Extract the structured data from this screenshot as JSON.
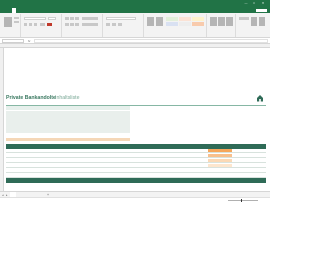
{
  "app": {
    "window_title": "",
    "accent": "#217346"
  },
  "window_controls": [
    {
      "name": "minimize-icon",
      "glyph": "—"
    },
    {
      "name": "maximize-icon",
      "glyph": "□"
    },
    {
      "name": "close-icon",
      "glyph": "✕"
    }
  ],
  "menu": {
    "items": [
      "",
      "",
      "",
      "",
      "",
      "",
      "",
      "",
      "",
      ""
    ],
    "active_index": 1
  },
  "formula_bar": {
    "name_box": "",
    "fx_label": "fx",
    "formula": ""
  },
  "sheet": {
    "title": "Private Bankandolte",
    "subtitle": "Inhaltsliste",
    "total_label": "",
    "total_value": "",
    "date_label": "",
    "date_value": "",
    "info": [
      {
        "label": "",
        "value": ""
      },
      {
        "label": "",
        "value": ""
      },
      {
        "label": "",
        "value": ""
      }
    ],
    "notes": [
      {
        "label": "",
        "value": ""
      },
      {
        "label": "",
        "value": ""
      },
      {
        "label": "",
        "value": ""
      },
      {
        "label": "",
        "value": ""
      },
      {
        "label": "",
        "value": ""
      },
      {
        "label": "",
        "value": ""
      }
    ],
    "instructions": "",
    "highlight_color": "#f5a65b",
    "header_color": "#2f6b57"
  },
  "table": {
    "columns": [
      "",
      "",
      "",
      "",
      "",
      "",
      "",
      "",
      "",
      "",
      ""
    ],
    "rows": [
      [
        "",
        "",
        "",
        "",
        "",
        "",
        "",
        "",
        "",
        "",
        ""
      ],
      [
        "",
        "",
        "",
        "",
        "",
        "",
        "",
        "",
        "",
        "",
        ""
      ],
      [
        "",
        "",
        "",
        "",
        "",
        "",
        "",
        "",
        "",
        "",
        ""
      ],
      [
        "",
        "",
        "",
        "",
        "",
        "",
        "",
        "",
        "",
        "",
        ""
      ],
      [
        "",
        "",
        "",
        "",
        "",
        "",
        "",
        "",
        "",
        "",
        ""
      ],
      [
        "",
        "",
        "",
        "",
        "",
        "",
        "",
        "",
        "",
        "",
        ""
      ]
    ],
    "sum_label": "",
    "sum_values": [
      "",
      "",
      ""
    ]
  },
  "tabs": {
    "active": "",
    "add_label": "+"
  },
  "status": {
    "zoom": ""
  }
}
